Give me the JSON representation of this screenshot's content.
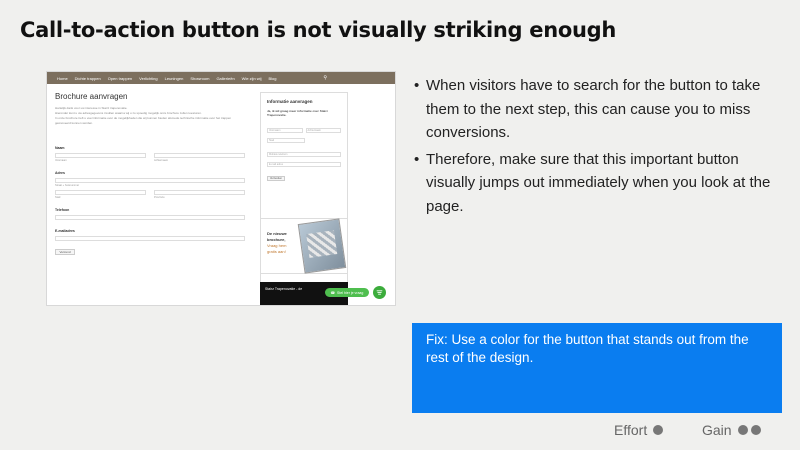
{
  "slide": {
    "title": "Call-to-action button is not visually striking enough"
  },
  "screenshot": {
    "nav": [
      "Home",
      "Dichte trappen",
      "Open trappen",
      "Verlichting",
      "Leuningen",
      "Showroom",
      "Gallerieën",
      "Wie zijn wij",
      "Blog"
    ],
    "page_title": "Brochure aanvragen",
    "intro": [
      "Hartelijk dank voor uw interesse in Stairz trapenovatie.",
      "Hieronder kunt u uw adresgegevens invullen waarna wij u zo spoedig mogelijk onze brochure zullen toesturen.",
      "In onze brochure treft u veel informatie over de mogelijkheden die wij kunnen bieden alsmede technische informatie over het trappen geënoveerd kunnen worden."
    ],
    "labels": {
      "name": "Naam",
      "first": "Voornaam",
      "last": "Achternaam",
      "address": "Adres",
      "street": "Straat + huisnummer",
      "city": "Stad",
      "province": "Provincie",
      "phone": "Telefoon",
      "email": "E-mailadres",
      "submit": "Verzend"
    },
    "sidebar": {
      "title": "Informatie aanvragen",
      "subtitle": "Ja, ik wil graag meer informatie over Stairz Trapenovatie.",
      "first": "Voornaam",
      "last": "Achternaam",
      "city": "Stad",
      "phone": "Mobiele telefoon",
      "email": "E-mail adres",
      "submit": "Verzenden"
    },
    "brochure": {
      "line1": "De nieuwe",
      "line2": "brochure,",
      "line3": "Vraag hem",
      "line4": "gratis aan!"
    },
    "video_title": "Stairz Trapenovatie - de",
    "whatsapp": "Stel hier je vraag"
  },
  "bullets": [
    "When visitors have to search for the button to take them to the next step, this can cause you to miss conversions.",
    "Therefore, make sure that this important button visually jumps out immediately when you look at the page."
  ],
  "fix": "Fix: Use a color for the button that stands out from the rest of the design.",
  "rating": {
    "effort_label": "Effort",
    "effort_dots": 1,
    "gain_label": "Gain",
    "gain_dots": 2
  },
  "colors": {
    "fix_bg": "#0a7df0",
    "nav_bg": "#7c6f5e",
    "whatsapp": "#4fbe4f"
  }
}
